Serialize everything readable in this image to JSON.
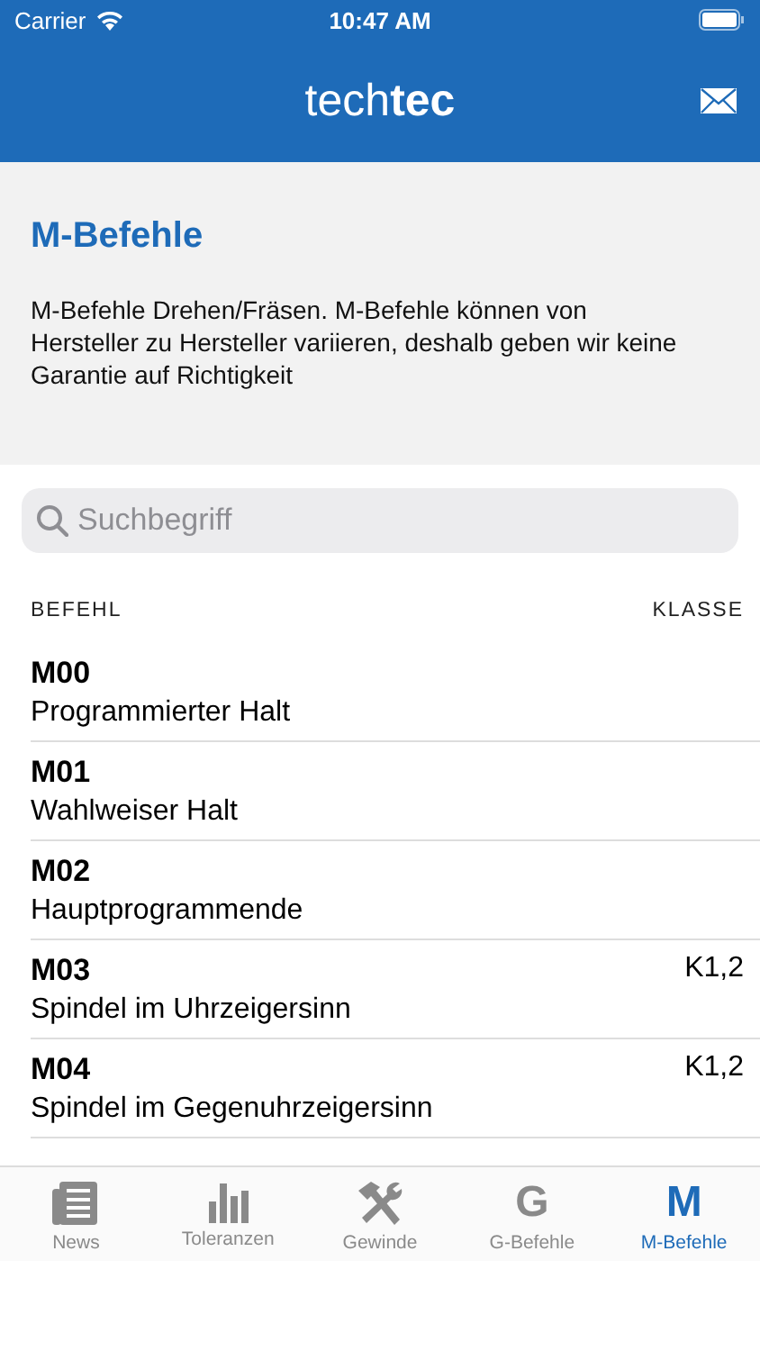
{
  "status_bar": {
    "carrier": "Carrier",
    "time": "10:47 AM"
  },
  "header": {
    "logo_light": "tech",
    "logo_bold": "tec"
  },
  "intro": {
    "title": "M-Befehle",
    "description": "M-Befehle Drehen/Fräsen. M-Befehle können von Hersteller zu Hersteller variieren, deshalb geben wir keine Garantie auf Richtigkeit"
  },
  "search": {
    "placeholder": "Suchbegriff"
  },
  "table": {
    "columns": [
      "BEFEHL",
      "KLASSE"
    ],
    "rows": [
      {
        "code": "M00",
        "name": "Programmierter Halt"
      },
      {
        "code": "M01",
        "name": "Wahlweiser Halt"
      },
      {
        "code": "M02",
        "name": "Hauptprogrammende"
      },
      {
        "code": "M03",
        "name": "Spindel im Uhrzeigersinn",
        "class": "K1,2"
      },
      {
        "code": "M04",
        "name": "Spindel im Gegenuhrzeigersinn",
        "class": "K1,2"
      }
    ]
  },
  "tabs": [
    {
      "label": "News",
      "kind": "news",
      "selected": false
    },
    {
      "label": "Toleranzen",
      "kind": "chart",
      "selected": false
    },
    {
      "label": "Gewinde",
      "kind": "tools",
      "selected": false
    },
    {
      "label": "G-Befehle",
      "kind": "letter",
      "glyph": "G",
      "selected": false
    },
    {
      "label": "M-Befehle",
      "kind": "letter",
      "glyph": "M",
      "selected": true
    }
  ]
}
